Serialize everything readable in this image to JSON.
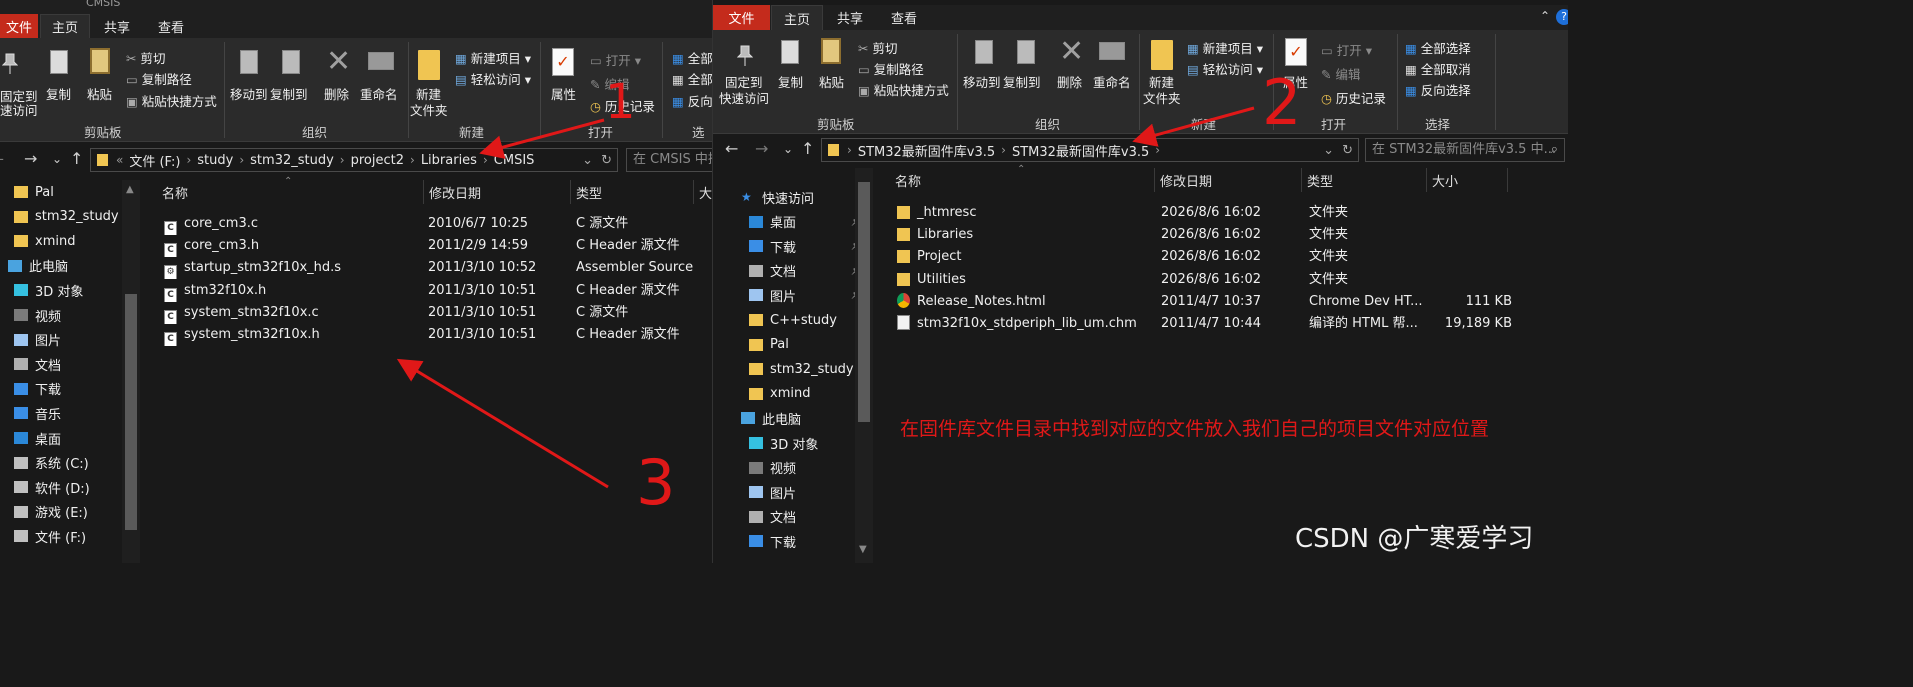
{
  "left_window": {
    "title": "CMSIS",
    "tabs": [
      "文件",
      "主页",
      "共享",
      "查看"
    ],
    "ribbon": {
      "pin_label_1": "固定到",
      "pin_label_2": "速访问",
      "copy": "复制",
      "paste": "粘贴",
      "cut": "剪切",
      "copy_path": "复制路径",
      "paste_shortcut": "粘贴快捷方式",
      "move_to": "移动到",
      "copy_to": "复制到",
      "delete": "删除",
      "rename": "重命名",
      "new_folder_1": "新建",
      "new_folder_2": "文件夹",
      "new_item": "新建项目",
      "easy_access": "轻松访问",
      "properties": "属性",
      "open": "打开",
      "edit": "编辑",
      "history": "历史记录",
      "select_all": "全部",
      "select_none": "全部",
      "invert": "反向",
      "group_clipboard": "剪贴板",
      "group_organize": "组织",
      "group_new": "新建",
      "group_open": "打开",
      "group_select": "选择"
    },
    "address": {
      "crumbs": [
        "文件 (F:)",
        "study",
        "stm32_study",
        "project2",
        "Libraries",
        "CMSIS"
      ],
      "search_placeholder": "在 CMSIS 中搜"
    },
    "nav": [
      {
        "label": "Pal",
        "icon": "folder-icon"
      },
      {
        "label": "stm32_study",
        "icon": "folder-icon"
      },
      {
        "label": "xmind",
        "icon": "folder-icon"
      },
      {
        "label": "此电脑",
        "icon": "computer-icon"
      },
      {
        "label": "3D 对象",
        "icon": "3d-objects-icon"
      },
      {
        "label": "视频",
        "icon": "video-icon"
      },
      {
        "label": "图片",
        "icon": "pictures-icon"
      },
      {
        "label": "文档",
        "icon": "documents-icon"
      },
      {
        "label": "下载",
        "icon": "download-icon"
      },
      {
        "label": "音乐",
        "icon": "music-icon"
      },
      {
        "label": "桌面",
        "icon": "desktop-icon"
      },
      {
        "label": "系统 (C:)",
        "icon": "drive-icon"
      },
      {
        "label": "软件 (D:)",
        "icon": "drive-icon"
      },
      {
        "label": "游戏 (E:)",
        "icon": "drive-icon"
      },
      {
        "label": "文件 (F:)",
        "icon": "drive-icon"
      }
    ],
    "columns": {
      "name": "名称",
      "date": "修改日期",
      "type": "类型",
      "size": "大"
    },
    "files": [
      {
        "name": "core_cm3.c",
        "date": "2010/6/7 10:25",
        "type": "C 源文件",
        "icon": "c-file-icon"
      },
      {
        "name": "core_cm3.h",
        "date": "2011/2/9 14:59",
        "type": "C Header 源文件",
        "icon": "c-file-icon"
      },
      {
        "name": "startup_stm32f10x_hd.s",
        "date": "2011/3/10 10:52",
        "type": "Assembler Source",
        "icon": "asm-file-icon"
      },
      {
        "name": "stm32f10x.h",
        "date": "2011/3/10 10:51",
        "type": "C Header 源文件",
        "icon": "c-file-icon"
      },
      {
        "name": "system_stm32f10x.c",
        "date": "2011/3/10 10:51",
        "type": "C 源文件",
        "icon": "c-file-icon"
      },
      {
        "name": "system_stm32f10x.h",
        "date": "2011/3/10 10:51",
        "type": "C Header 源文件",
        "icon": "c-file-icon"
      }
    ]
  },
  "right_window": {
    "tabs": [
      "文件",
      "主页",
      "共享",
      "查看"
    ],
    "ribbon": {
      "pin_label_1": "固定到",
      "pin_label_2": "快速访问",
      "copy": "复制",
      "paste": "粘贴",
      "cut": "剪切",
      "copy_path": "复制路径",
      "paste_shortcut": "粘贴快捷方式",
      "move_to": "移动到",
      "copy_to": "复制到",
      "delete": "删除",
      "rename": "重命名",
      "new_folder_1": "新建",
      "new_folder_2": "文件夹",
      "new_item": "新建项目",
      "easy_access": "轻松访问",
      "properties": "属性",
      "open": "打开",
      "edit": "编辑",
      "history": "历史记录",
      "select_all": "全部选择",
      "select_none": "全部取消",
      "invert": "反向选择",
      "group_clipboard": "剪贴板",
      "group_organize": "组织",
      "group_new": "新建",
      "group_open": "打开",
      "group_select": "选择"
    },
    "address": {
      "crumbs": [
        "STM32最新固件库v3.5",
        "STM32最新固件库v3.5"
      ],
      "search_placeholder": "在 STM32最新固件库v3.5 中..."
    },
    "nav": [
      {
        "label": "快速访问",
        "icon": "star-icon"
      },
      {
        "label": "桌面",
        "icon": "desktop-icon"
      },
      {
        "label": "下载",
        "icon": "download-icon"
      },
      {
        "label": "文档",
        "icon": "documents-icon"
      },
      {
        "label": "图片",
        "icon": "pictures-icon"
      },
      {
        "label": "C++study",
        "icon": "folder-icon"
      },
      {
        "label": "Pal",
        "icon": "folder-icon"
      },
      {
        "label": "stm32_study",
        "icon": "folder-icon"
      },
      {
        "label": "xmind",
        "icon": "folder-icon"
      },
      {
        "label": "此电脑",
        "icon": "computer-icon"
      },
      {
        "label": "3D 对象",
        "icon": "3d-objects-icon"
      },
      {
        "label": "视频",
        "icon": "video-icon"
      },
      {
        "label": "图片",
        "icon": "pictures-icon"
      },
      {
        "label": "文档",
        "icon": "documents-icon"
      },
      {
        "label": "下载",
        "icon": "download-icon"
      }
    ],
    "columns": {
      "name": "名称",
      "date": "修改日期",
      "type": "类型",
      "size": "大小"
    },
    "files": [
      {
        "name": "_htmresc",
        "date": "2026/8/6 16:02",
        "type": "文件夹",
        "size": "",
        "icon": "folder-icon"
      },
      {
        "name": "Libraries",
        "date": "2026/8/6 16:02",
        "type": "文件夹",
        "size": "",
        "icon": "folder-icon"
      },
      {
        "name": "Project",
        "date": "2026/8/6 16:02",
        "type": "文件夹",
        "size": "",
        "icon": "folder-icon"
      },
      {
        "name": "Utilities",
        "date": "2026/8/6 16:02",
        "type": "文件夹",
        "size": "",
        "icon": "folder-icon"
      },
      {
        "name": "Release_Notes.html",
        "date": "2011/4/7 10:37",
        "type": "Chrome Dev HT...",
        "size": "111 KB",
        "icon": "chrome-icon"
      },
      {
        "name": "stm32f10x_stdperiph_lib_um.chm",
        "date": "2011/4/7 10:44",
        "type": "编译的 HTML 帮...",
        "size": "19,189 KB",
        "icon": "chm-file-icon"
      }
    ]
  },
  "annotations": {
    "num1": "1",
    "num2": "2",
    "num3": "3",
    "caption": "在固件库文件目录中找到对应的文件放入我们自己的项目文件对应位置",
    "watermark": "CSDN @广寒爱学习",
    "color": "#e01818"
  }
}
